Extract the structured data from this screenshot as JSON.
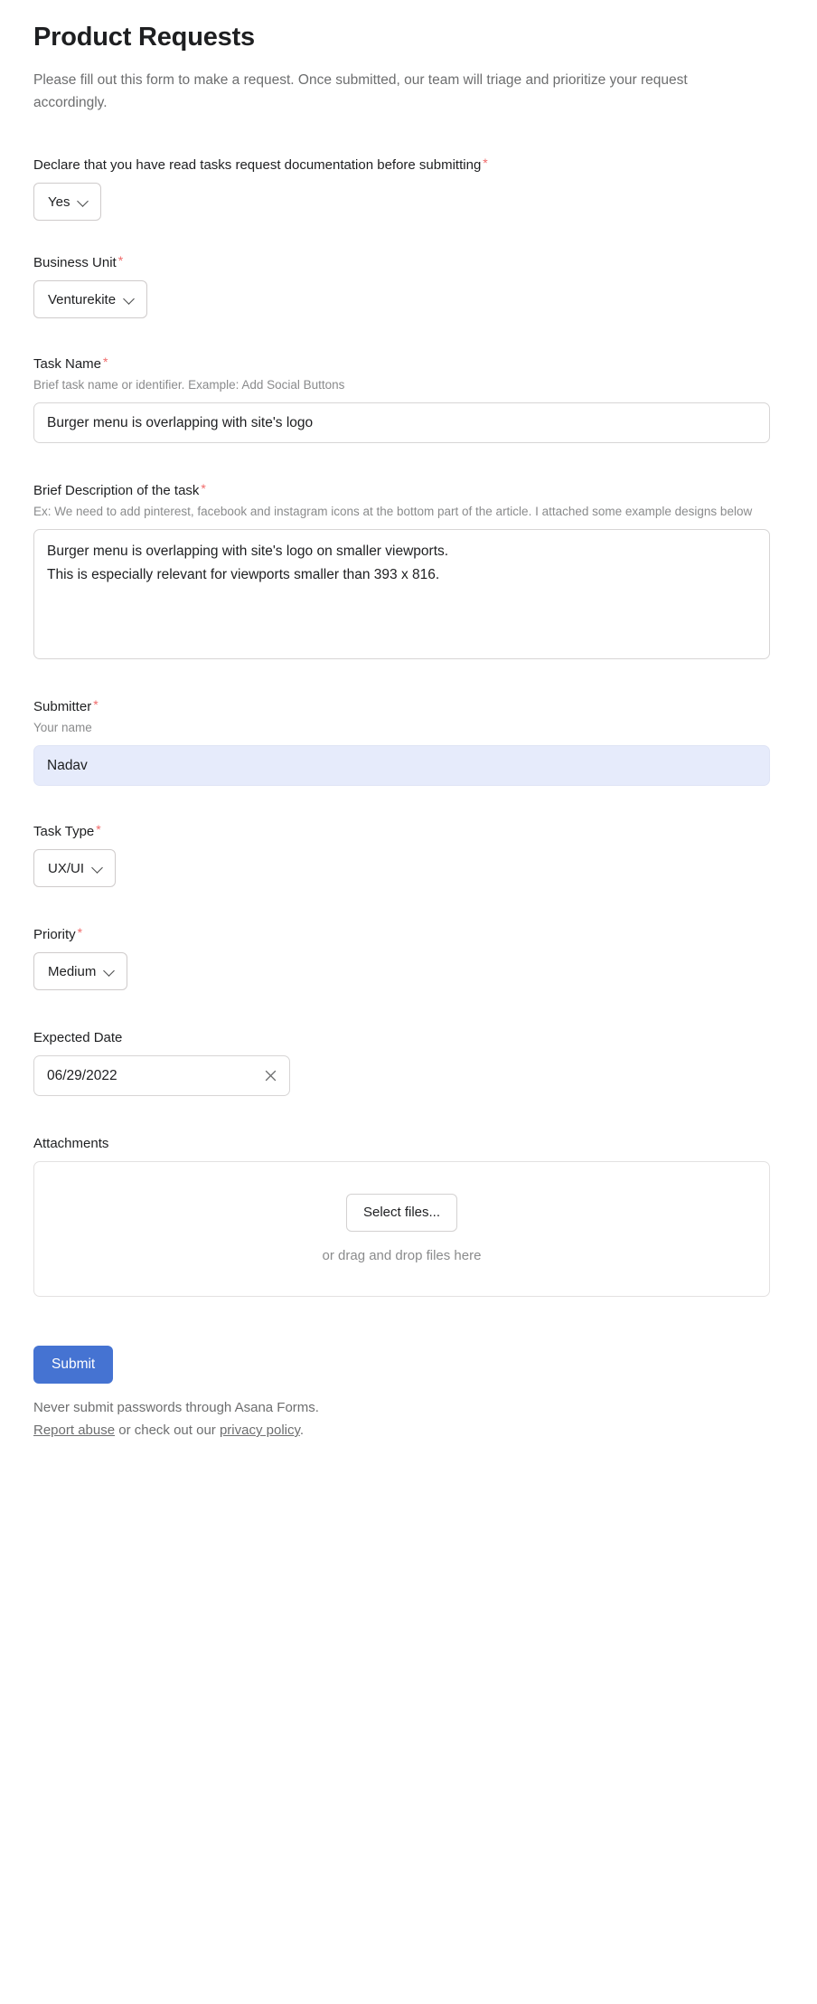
{
  "form": {
    "title": "Product Requests",
    "subtitle": "Please fill out this form to make a request. Once submitted, our team will triage and prioritize your request accordingly."
  },
  "fields": {
    "declare": {
      "label": "Declare that you have read tasks request documentation before submitting",
      "required_marker": "*",
      "value": "Yes",
      "chevron_icon": "chevron-down-icon"
    },
    "business_unit": {
      "label": "Business Unit",
      "required_marker": "*",
      "value": "Venturekite",
      "chevron_icon": "chevron-down-icon"
    },
    "task_name": {
      "label": "Task Name",
      "required_marker": "*",
      "hint": "Brief task name or identifier. Example: Add Social Buttons",
      "value": "Burger menu is overlapping with site's logo",
      "placeholder": ""
    },
    "description": {
      "label": "Brief Description of the task",
      "required_marker": "*",
      "hint": "Ex: We need to add pinterest, facebook and instagram icons at the bottom part of the article. I attached some example designs below",
      "value": "Burger menu is overlapping with site's logo on smaller viewports.\nThis is especially relevant for viewports smaller than 393 x 816.",
      "placeholder": ""
    },
    "submitter": {
      "label": "Submitter",
      "required_marker": "*",
      "hint": "Your name",
      "value": "Nadav",
      "placeholder": "Your name",
      "highlight_color": "#e6ebfb"
    },
    "task_type": {
      "label": "Task Type",
      "required_marker": "*",
      "value": "UX/UI",
      "chevron_icon": "chevron-down-icon"
    },
    "priority": {
      "label": "Priority",
      "required_marker": "*",
      "value": "Medium",
      "chevron_icon": "chevron-down-icon"
    },
    "expected_date": {
      "label": "Expected Date",
      "required_marker": "",
      "value": "06/29/2022",
      "placeholder": "MM/DD/YYYY",
      "clear_icon": "close-icon"
    },
    "attachments": {
      "label": "Attachments",
      "required_marker": "",
      "select_files_label": "Select files...",
      "drag_drop_label": "or drag and drop files here"
    }
  },
  "actions": {
    "submit_label": "Submit"
  },
  "footer": {
    "notice": "Never submit passwords through Asana Forms.",
    "report_abuse_label": "Report abuse",
    "middle_text": " or check out our ",
    "privacy_policy_label": "privacy policy",
    "trailing_period": "."
  },
  "colors": {
    "accent": "#4573d2",
    "required_asterisk": "#f06a6a",
    "highlight_field": "#e6ebfb",
    "text_primary": "#1e1f21",
    "text_muted": "#6d6e6f"
  }
}
